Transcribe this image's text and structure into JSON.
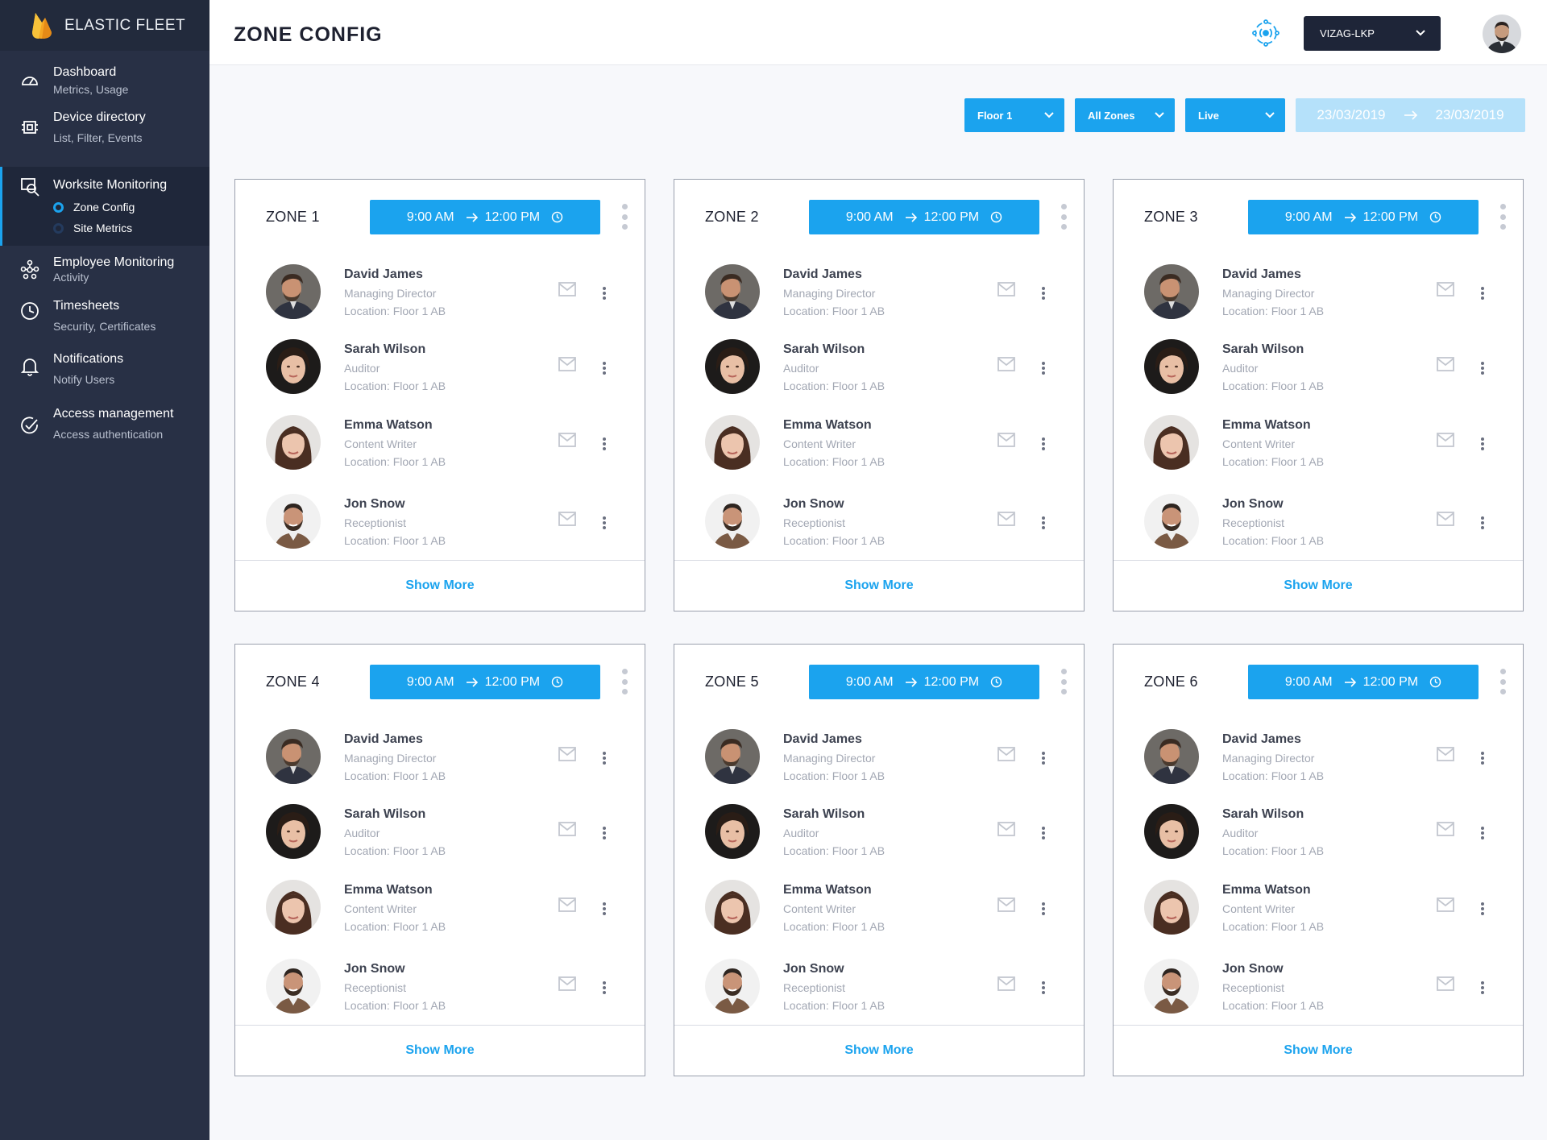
{
  "brand": {
    "name": "ELASTIC FLEET"
  },
  "sidebar": {
    "items": [
      {
        "label": "Dashboard",
        "sub": "Metrics, Usage",
        "icon": "gauge-icon"
      },
      {
        "label": "Device directory",
        "sub": "List, Filter, Events",
        "icon": "chip-icon"
      },
      {
        "label": "Worksite Monitoring",
        "icon": "monitor-search-icon",
        "active": true,
        "children": [
          {
            "label": "Zone Config",
            "active": true
          },
          {
            "label": "Site Metrics",
            "active": false
          }
        ]
      },
      {
        "label": "Employee Monitoring",
        "sub": "Activity",
        "icon": "network-icon"
      },
      {
        "label": "Timesheets",
        "sub": "Security, Certificates",
        "icon": "clock-icon"
      },
      {
        "label": "Notifications",
        "sub": "Notify Users",
        "icon": "bell-icon"
      },
      {
        "label": "Access management",
        "sub": "Access authentication",
        "icon": "check-circle-icon"
      }
    ]
  },
  "header": {
    "title": "ZONE CONFIG",
    "site": "VIZAG-LKP"
  },
  "filters": {
    "floor": "Floor 1",
    "zones": "All Zones",
    "mode": "Live",
    "date_from": "23/03/2019",
    "date_to": "23/03/2019"
  },
  "zones": [
    {
      "title": "ZONE 1",
      "start": "9:00 AM",
      "end": "12:00 PM",
      "show_more": "Show More"
    },
    {
      "title": "ZONE 2",
      "start": "9:00 AM",
      "end": "12:00 PM",
      "show_more": "Show More"
    },
    {
      "title": "ZONE 3",
      "start": "9:00 AM",
      "end": "12:00 PM",
      "show_more": "Show More"
    },
    {
      "title": "ZONE 4",
      "start": "9:00 AM",
      "end": "12:00 PM",
      "show_more": "Show More"
    },
    {
      "title": "ZONE 5",
      "start": "9:00 AM",
      "end": "12:00 PM",
      "show_more": "Show More"
    },
    {
      "title": "ZONE 6",
      "start": "9:00 AM",
      "end": "12:00 PM",
      "show_more": "Show More"
    }
  ],
  "people": [
    {
      "name": "David James",
      "role": "Managing Director",
      "location": "Location: Floor 1 AB"
    },
    {
      "name": "Sarah Wilson",
      "role": "Auditor",
      "location": "Location: Floor 1 AB"
    },
    {
      "name": "Emma Watson",
      "role": "Content Writer",
      "location": "Location: Floor 1 AB"
    },
    {
      "name": "Jon Snow",
      "role": "Receptionist",
      "location": "Location: Floor 1 AB"
    }
  ],
  "colors": {
    "accent": "#1ba3ee",
    "sidebar": "#283045",
    "sidebar_dark": "#222a3c",
    "date_range": "#b5e1fa"
  }
}
